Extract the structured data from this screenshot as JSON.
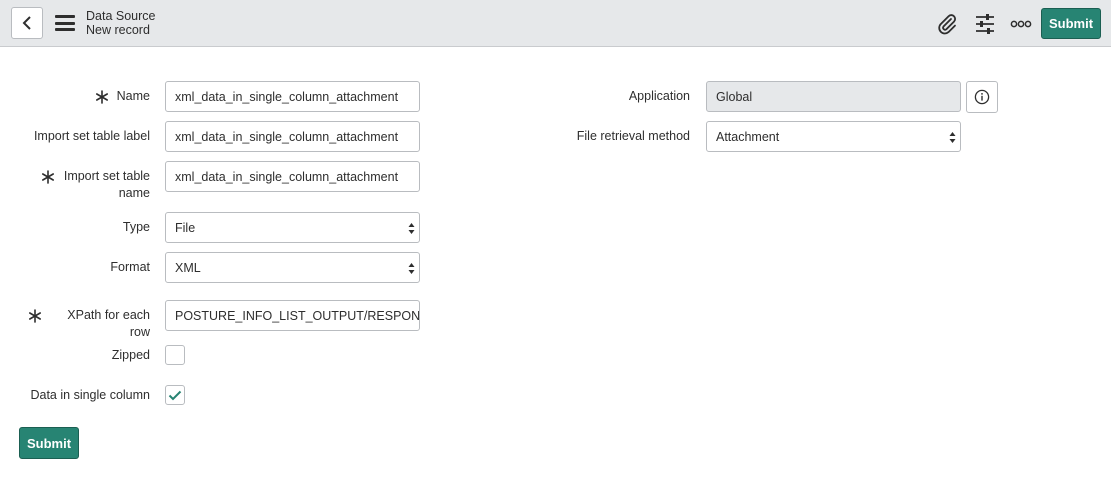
{
  "header": {
    "title": "Data Source",
    "subtitle": "New record",
    "submit_label": "Submit"
  },
  "form": {
    "name": {
      "label": "Name",
      "value": "xml_data_in_single_column_attachment",
      "required": true
    },
    "import_set_table_label": {
      "label": "Import set table label",
      "value": "xml_data_in_single_column_attachment"
    },
    "import_set_table_name": {
      "label_line1": "Import set table",
      "label_line2": "name",
      "value": "xml_data_in_single_column_attachment",
      "required": true
    },
    "type": {
      "label": "Type",
      "value": "File"
    },
    "format": {
      "label": "Format",
      "value": "XML"
    },
    "xpath": {
      "label": "XPath for each row",
      "value": "POSTURE_INFO_LIST_OUTPUT/RESPONSE",
      "required": true
    },
    "zipped": {
      "label": "Zipped",
      "checked": false
    },
    "data_in_single_column": {
      "label": "Data in single column",
      "checked": true
    },
    "application": {
      "label": "Application",
      "value": "Global"
    },
    "file_retrieval_method": {
      "label": "File retrieval method",
      "value": "Attachment"
    }
  },
  "footer": {
    "submit_label": "Submit"
  },
  "icons": {
    "back": "chevron-left-icon",
    "menu": "hamburger-menu-icon",
    "attachment": "paperclip-icon",
    "settings": "sliders-icon",
    "more": "more-options-icon",
    "info": "info-icon",
    "required": "asterisk-icon",
    "check": "checkmark-icon"
  },
  "colors": {
    "accent": "#278473",
    "header_bg": "#e6e8ea",
    "border": "#b9bcc0"
  }
}
